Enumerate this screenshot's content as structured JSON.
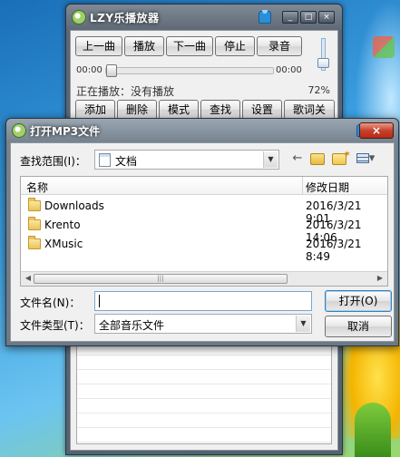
{
  "player": {
    "title": "LZY乐播放器",
    "caption": {
      "minimize": "_",
      "maximize": "□",
      "close": "×"
    },
    "controls": [
      "上一曲",
      "播放",
      "下一曲",
      "停止",
      "录音"
    ],
    "time_start": "00:00",
    "time_end": "00:00",
    "progress": 0,
    "volume_percent": "72%",
    "now_playing_label": "正在播放：",
    "now_playing_value": "没有播放",
    "actions": [
      "添加",
      "删除",
      "模式",
      "查找",
      "设置",
      "歌词关"
    ]
  },
  "dialog": {
    "title": "打开MP3文件",
    "close": "×",
    "look_in_label": "查找范围(I)：",
    "look_in_value": "文档",
    "toolbar_icons": [
      "back-arrow-icon",
      "folder-up-icon",
      "new-folder-icon",
      "view-menu-icon"
    ],
    "columns": {
      "name": "名称",
      "modified": "修改日期"
    },
    "files": [
      {
        "name": "Downloads",
        "modified": "2016/3/21 9:01"
      },
      {
        "name": "Krento",
        "modified": "2016/3/21 14:06"
      },
      {
        "name": "XMusic",
        "modified": "2016/3/21 8:49"
      }
    ],
    "filename_label": "文件名(N)：",
    "filename_value": "",
    "filetype_label": "文件类型(T)：",
    "filetype_value": "全部音乐文件",
    "open_button": "打开(O)",
    "cancel_button": "取消"
  },
  "colors": {
    "title_text": "#ffffff",
    "dialog_close": "#c7402b",
    "accent": "#3c7fb1"
  }
}
